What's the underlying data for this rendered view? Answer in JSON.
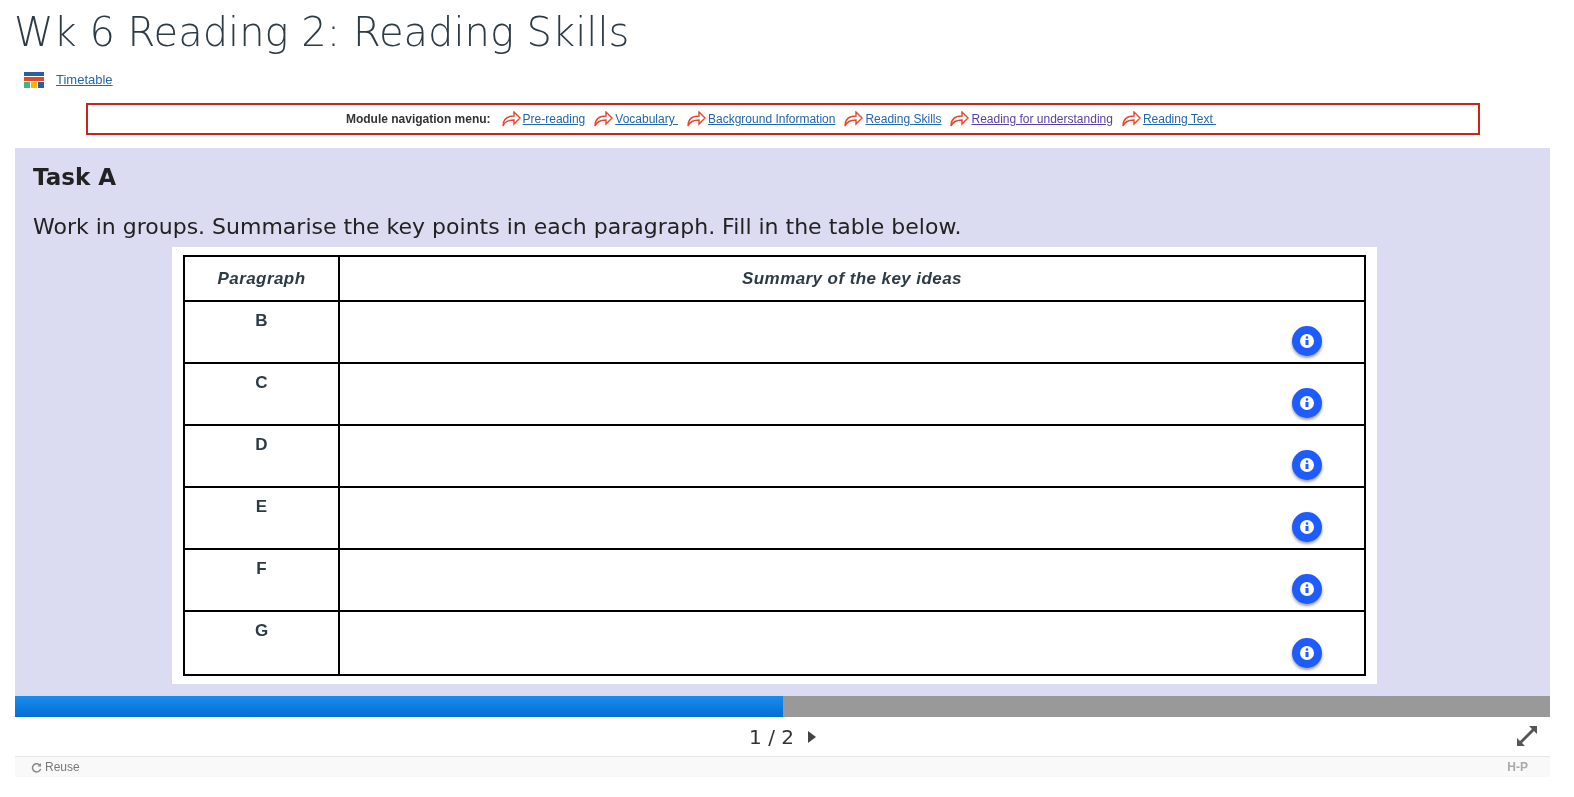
{
  "page_title": "Wk 6 Reading 2: Reading Skills",
  "timetable_link": "Timetable",
  "module_nav": {
    "label": "Module navigation menu:",
    "links": [
      {
        "text": "Pre-reading",
        "visited": false
      },
      {
        "text": "Vocabulary ",
        "visited": false
      },
      {
        "text": "Background Information",
        "visited": false
      },
      {
        "text": "Reading Skills",
        "visited": false
      },
      {
        "text": "Reading for understanding",
        "visited": true
      },
      {
        "text": "Reading Text ",
        "visited": false
      }
    ]
  },
  "task": {
    "heading": "Task A",
    "instruction": "Work in groups. Summarise the key points in each paragraph. Fill in the table below.",
    "table": {
      "columns": [
        "Paragraph",
        "Summary of the key ideas"
      ],
      "rows": [
        "B",
        "C",
        "D",
        "E",
        "F",
        "G"
      ]
    }
  },
  "progress": {
    "level": 0.5
  },
  "pager": {
    "current": "1",
    "separator": "/",
    "total": "2"
  },
  "footer": {
    "reuse": "Reuse",
    "logo": "H-P"
  }
}
